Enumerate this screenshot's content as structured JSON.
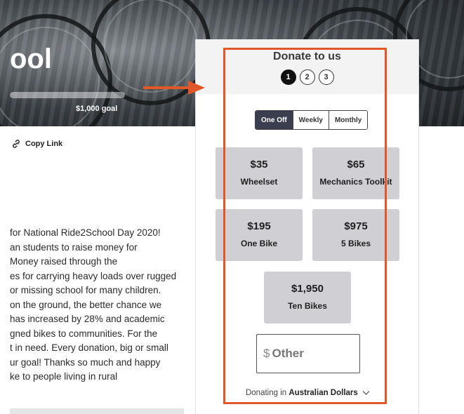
{
  "hero": {
    "title_fragment": "ool",
    "goal": "$1,000 goal",
    "progress_fraction": 0.0
  },
  "copy_link": {
    "label": "Copy Link",
    "icon": "link-icon"
  },
  "story": {
    "lines": [
      "for National Ride2School Day 2020!",
      "an students to raise money for",
      " Money raised through the",
      "es for carrying heavy loads over rugged",
      " or missing school for many children.",
      "on the ground, the better chance we",
      "has increased by 28% and academic",
      "gned bikes to communities. For the",
      "t in need. Every donation, big or small",
      "ur goal! Thanks so much and happy",
      "ke to people living in rural"
    ]
  },
  "donate": {
    "title": "Donate to us",
    "steps": [
      "1",
      "2",
      "3"
    ],
    "active_step": "1",
    "frequency": {
      "options": [
        "One Off",
        "Weekly",
        "Monthly"
      ],
      "selected": "One Off"
    },
    "amounts": [
      {
        "value": "$35",
        "label": "Wheelset"
      },
      {
        "value": "$65",
        "label": "Mechanics Toolkit"
      },
      {
        "value": "$195",
        "label": "One Bike"
      },
      {
        "value": "$975",
        "label": "5 Bikes"
      },
      {
        "value": "$1,950",
        "label": "Ten Bikes"
      }
    ],
    "other": {
      "currency_symbol": "$",
      "placeholder": "Other"
    },
    "currency_prefix": "Donating in",
    "currency_name": "Australian Dollars"
  },
  "colors": {
    "highlight": "#e0582a",
    "selected_frequency": "#3b3e4f",
    "amount_tile": "#cfcfd4"
  }
}
